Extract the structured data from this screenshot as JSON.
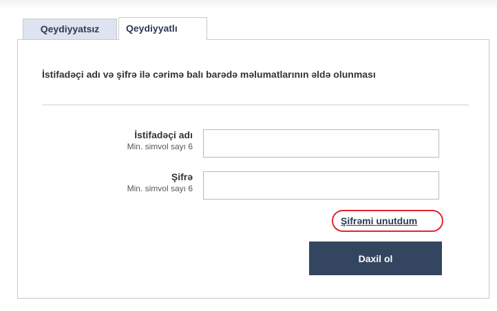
{
  "tabs": [
    {
      "label": "Qeydiyyatsız",
      "active": false
    },
    {
      "label": "Qeydiyyatlı",
      "active": true
    }
  ],
  "form": {
    "heading": "İstifadəçi adı və şifrə ilə cərimə balı barədə məlumatlarının əldə olunması",
    "username": {
      "label": "İstifadəçi adı",
      "hint": "Min. simvol sayı 6",
      "value": ""
    },
    "password": {
      "label": "Şifrə",
      "hint": "Min. simvol sayı 6",
      "value": ""
    },
    "forgot_password_label": "Şifrəmi unutdum",
    "submit_label": "Daxil ol"
  },
  "colors": {
    "primary": "#34465f",
    "tab_inactive_bg": "#dde3ef",
    "highlight": "#e0242c"
  }
}
